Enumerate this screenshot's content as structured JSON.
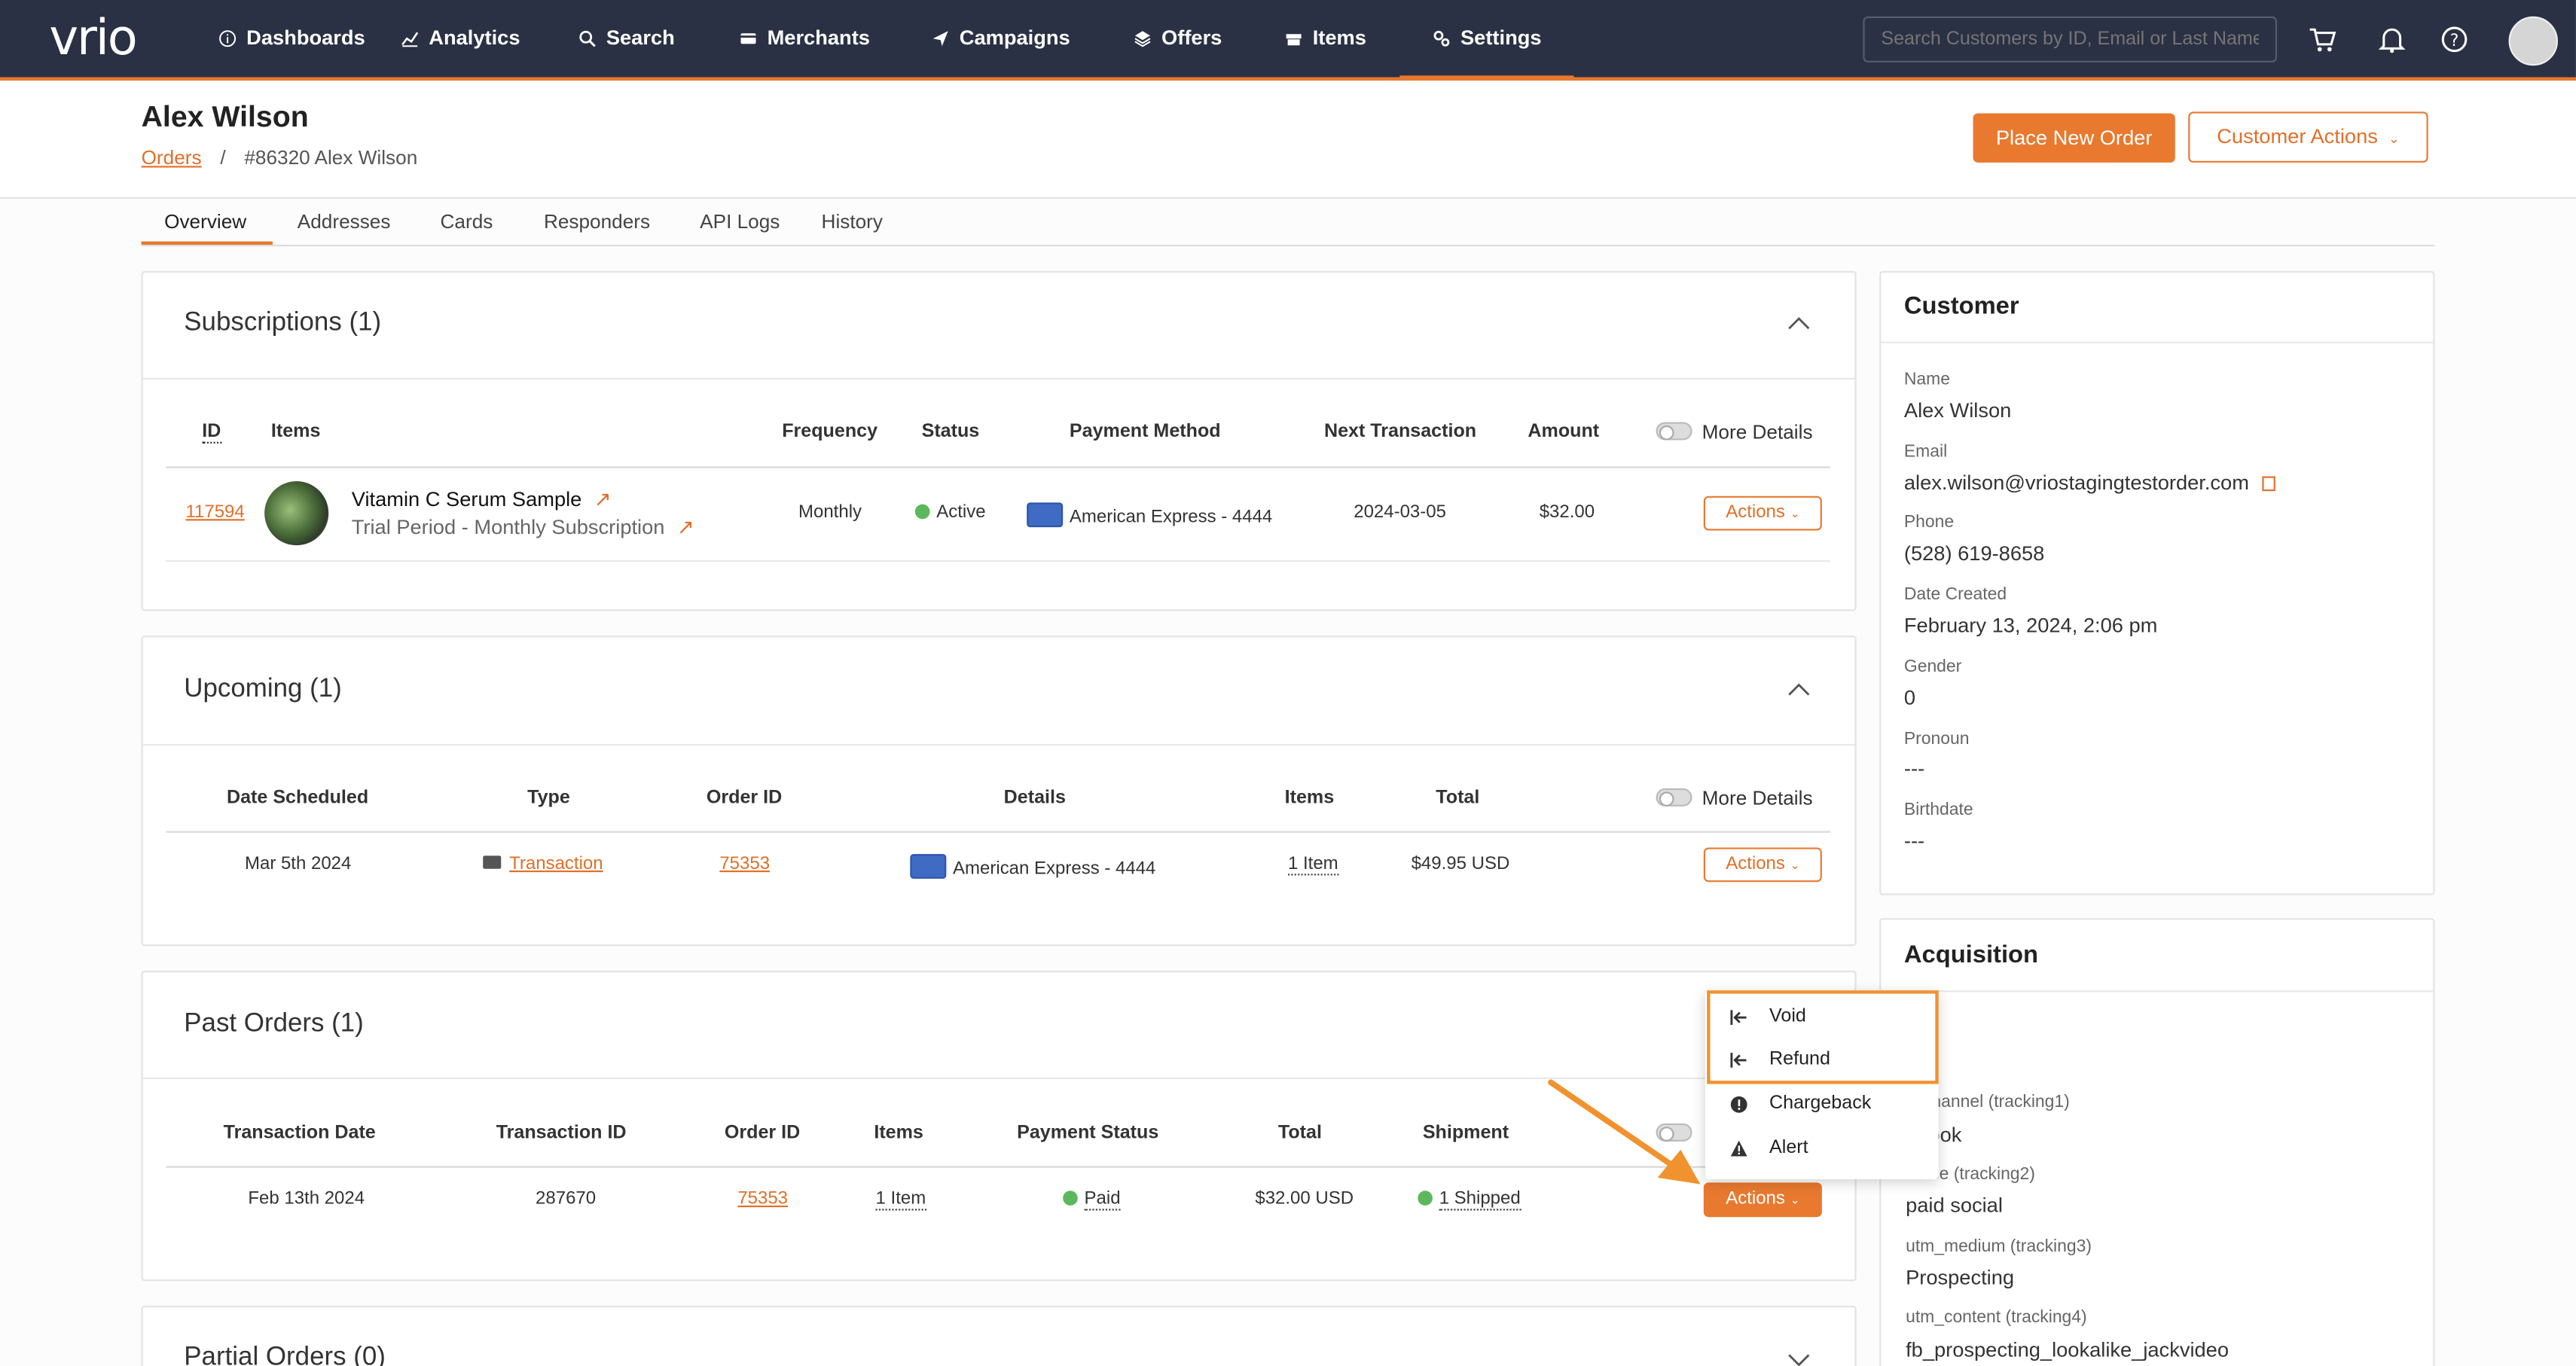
{
  "app": {
    "logo": "vrio"
  },
  "nav": {
    "items": [
      {
        "label": "Dashboards",
        "icon": "info-icon"
      },
      {
        "label": "Analytics",
        "icon": "chart-line-icon"
      },
      {
        "label": "Search",
        "icon": "search-icon"
      },
      {
        "label": "Merchants",
        "icon": "card-icon"
      },
      {
        "label": "Campaigns",
        "icon": "send-icon"
      },
      {
        "label": "Offers",
        "icon": "layers-icon"
      },
      {
        "label": "Items",
        "icon": "box-icon"
      },
      {
        "label": "Settings",
        "icon": "gears-icon"
      }
    ],
    "active": "Settings",
    "search_placeholder": "Search Customers by ID, Email or Last Name"
  },
  "header": {
    "title": "Alex Wilson",
    "breadcrumb_link": "Orders",
    "breadcrumb_sep": "/",
    "breadcrumb_current": "#86320 Alex Wilson",
    "place_order": "Place New Order",
    "customer_actions": "Customer Actions"
  },
  "tabs": [
    "Overview",
    "Addresses",
    "Cards",
    "Responders",
    "API Logs",
    "History"
  ],
  "subscriptions": {
    "title": "Subscriptions (1)",
    "headers": [
      "ID",
      "Items",
      "Frequency",
      "Status",
      "Payment Method",
      "Next Transaction",
      "Amount"
    ],
    "more_details": "More Details",
    "row": {
      "id": "117594",
      "item_name": "Vitamin C Serum Sample",
      "item_sub": "Trial Period - Monthly Subscription",
      "frequency": "Monthly",
      "status": "Active",
      "payment": "American Express - 4444",
      "next": "2024-03-05",
      "amount": "$32.00",
      "actions": "Actions"
    }
  },
  "upcoming": {
    "title": "Upcoming (1)",
    "headers": [
      "Date Scheduled",
      "Type",
      "Order ID",
      "Details",
      "Items",
      "Total"
    ],
    "more_details": "More Details",
    "row": {
      "date": "Mar 5th 2024",
      "type": "Transaction",
      "order_id": "75353",
      "details": "American Express - 4444",
      "items": "1 Item",
      "total": "$49.95 USD",
      "actions": "Actions"
    }
  },
  "past_orders": {
    "title": "Past Orders (1)",
    "headers": [
      "Transaction Date",
      "Transaction ID",
      "Order ID",
      "Items",
      "Payment Status",
      "Total",
      "Shipment"
    ],
    "row": {
      "date": "Feb 13th 2024",
      "transaction_id": "287670",
      "order_id": "75353",
      "items": "1 Item",
      "payment_status": "Paid",
      "total": "$32.00 USD",
      "shipment": "1 Shipped",
      "actions": "Actions"
    }
  },
  "partial_orders": {
    "title": "Partial Orders (0)"
  },
  "actions_menu": [
    {
      "label": "Void",
      "icon": "arrow-left-bar-icon"
    },
    {
      "label": "Refund",
      "icon": "arrow-left-bar-icon"
    },
    {
      "label": "Chargeback",
      "icon": "exclamation-circle-icon"
    },
    {
      "label": "Alert",
      "icon": "warning-triangle-icon"
    }
  ],
  "customer": {
    "title": "Customer",
    "fields": [
      {
        "label": "Name",
        "value": "Alex Wilson"
      },
      {
        "label": "Email",
        "value": "alex.wilson@vriostagingtestorder.com"
      },
      {
        "label": "Phone",
        "value": "(528) 619-8658"
      },
      {
        "label": "Date Created",
        "value": "February 13, 2024, 2:06 pm"
      },
      {
        "label": "Gender",
        "value": "0"
      },
      {
        "label": "Pronoun",
        "value": "---"
      },
      {
        "label": "Birthdate",
        "value": "---"
      }
    ]
  },
  "acquisition": {
    "title": "Acquisition",
    "fields": [
      {
        "label": "s Channel (tracking1)",
        "value": "ebook"
      },
      {
        "label": "ource (tracking2)",
        "value": "paid social"
      },
      {
        "label": "utm_medium (tracking3)",
        "value": "Prospecting"
      },
      {
        "label": "utm_content (tracking4)",
        "value": "fb_prospecting_lookalike_jackvideo"
      }
    ]
  },
  "colors": {
    "accent": "#e8792f",
    "nav_bg": "#2b3144",
    "active_green": "#5cb85c"
  }
}
